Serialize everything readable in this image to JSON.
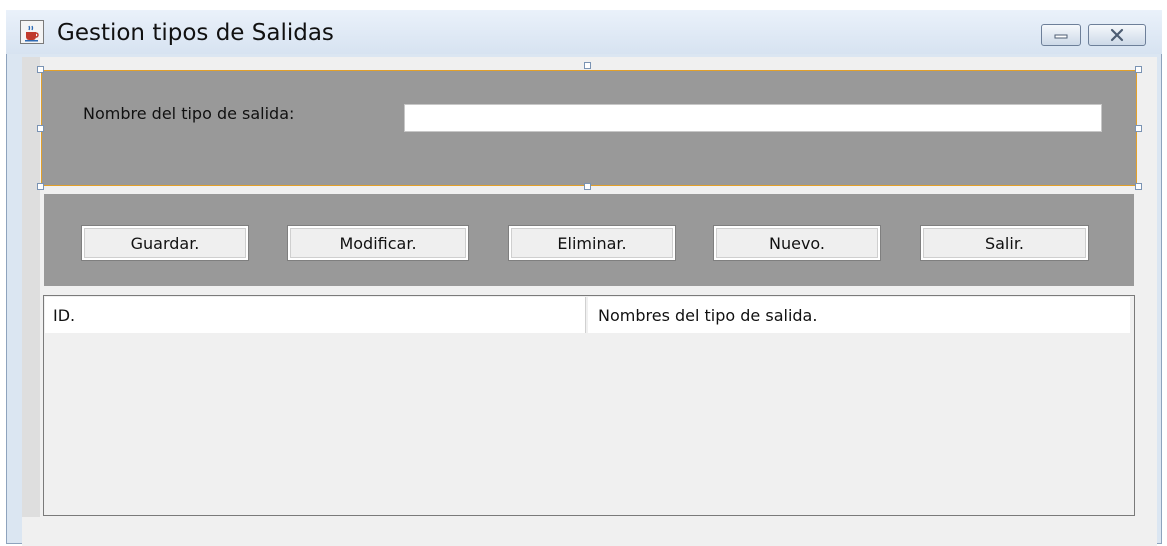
{
  "window": {
    "title": "Gestion tipos de Salidas"
  },
  "form": {
    "name_label": "Nombre del tipo de salida:",
    "name_value": "",
    "name_placeholder": ""
  },
  "buttons": {
    "save": "Guardar.",
    "modify": "Modificar.",
    "delete": "Eliminar.",
    "new": "Nuevo.",
    "exit": "Salir."
  },
  "table": {
    "columns": [
      "ID.",
      "Nombres del tipo de salida."
    ],
    "rows": []
  },
  "colors": {
    "panel": "#999999",
    "selection_border": "#e2a02a",
    "content_bg": "#f0f0f0"
  },
  "icons": {
    "app": "java-coffee-icon",
    "minimize": "minimize-icon",
    "close": "close-icon"
  }
}
